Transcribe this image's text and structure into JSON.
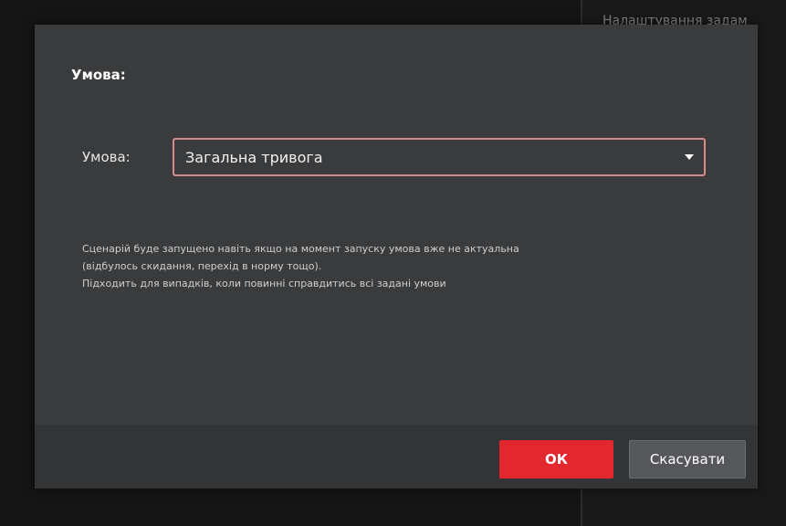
{
  "background": {
    "right_text": "Налаштування задам"
  },
  "dialog": {
    "title": "Умова:",
    "condition": {
      "label": "Умова:",
      "selected": "Загальна тривога"
    },
    "hint_lines": [
      "Сценарій буде запущено навіть якщо на момент запуску умова вже не актуальна",
      "(відбулось скидання, перехід в норму тощо).",
      "Підходить для випадків, коли повинні справдитись всі задані умови"
    ],
    "buttons": {
      "ok": "ОК",
      "cancel": "Скасувати"
    }
  },
  "colors": {
    "accent": "#e2272f",
    "select_border": "#d98a8a",
    "dialog_bg": "#3a3b3d"
  },
  "icons": {
    "dropdown": "chevron-down-icon"
  }
}
